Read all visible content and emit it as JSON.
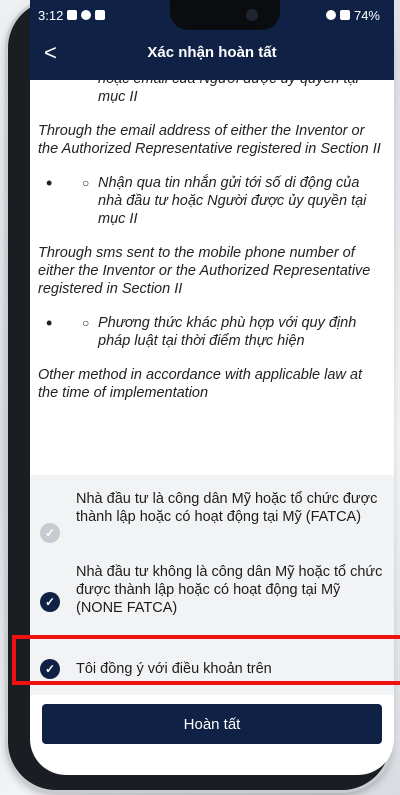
{
  "status_bar": {
    "time": "3:12",
    "battery": "74%"
  },
  "header": {
    "back_icon": "<",
    "title": "Xác nhận hoàn tất"
  },
  "content": {
    "top_fragment": "hoặc email của Người được ủy quyền tại",
    "top_fragment2": "mục II",
    "email_en": "Through the email address of either the Inventor or the Authorized Representative registered in Section II",
    "sms_vi": "Nhận qua tin nhắn gửi tới số di động của nhà đầu tư hoặc Người được ủy quyền tại mục II",
    "sms_en": "Through sms sent to the mobile phone number of either the Inventor or the Authorized Representative registered in Section II",
    "other_vi": "Phương thức khác phù hợp với quy định pháp luật tại thời điểm thực hiện",
    "other_en": "Other method in accordance with applicable law at the time of implementation"
  },
  "options": {
    "fatca": "Nhà đầu tư là công dân Mỹ hoặc tổ chức được thành lập hoặc có hoạt động tại Mỹ (FATCA)",
    "none_fatca": "Nhà đầu tư không là công dân Mỹ hoặc tổ chức được thành lập hoặc có hoạt động tại Mỹ (NONE FATCA)",
    "agree": "Tôi đồng ý với điều khoản trên"
  },
  "button": {
    "submit": "Hoàn tất"
  }
}
